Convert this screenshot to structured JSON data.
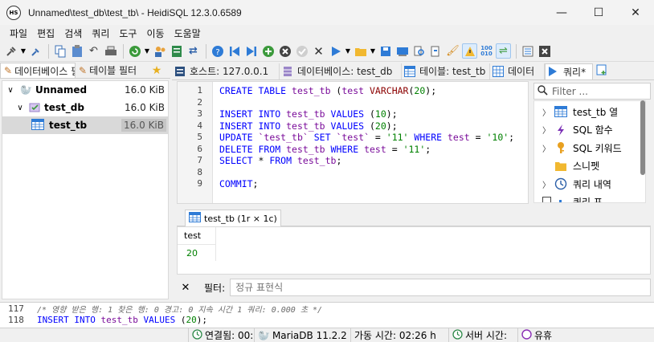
{
  "window": {
    "title": "Unnamed\\test_db\\test_tb\\ - HeidiSQL 12.3.0.6589",
    "icon_text": "HS",
    "minimize": "—",
    "maximize": "☐",
    "close": "✕"
  },
  "menu": [
    "파일",
    "편집",
    "검색",
    "쿼리",
    "도구",
    "이동",
    "도움말"
  ],
  "left_tabs": {
    "database_filter": "데이터베이스 필터",
    "table_filter": "테이블 필터"
  },
  "tree": [
    {
      "label": "Unnamed",
      "size": "16.0 KiB"
    },
    {
      "label": "test_db",
      "size": "16.0 KiB"
    },
    {
      "label": "test_tb",
      "size": "16.0 KiB"
    }
  ],
  "right_tabs": [
    {
      "label": "호스트: 127.0.0.1"
    },
    {
      "label": "데이터베이스: test_db"
    },
    {
      "label": "테이블: test_tb"
    },
    {
      "label": "데이터"
    },
    {
      "label": "쿼리*"
    }
  ],
  "editor": {
    "line_numbers": [
      "1",
      "2",
      "3",
      "4",
      "5",
      "6",
      "7",
      "8",
      "9"
    ]
  },
  "helpers": {
    "filter_placeholder": "Filter ...",
    "items": [
      {
        "label": "test_tb 열",
        "icon": "table-icon"
      },
      {
        "label": "SQL 함수",
        "icon": "function-icon"
      },
      {
        "label": "SQL 키워드",
        "icon": "key-icon"
      },
      {
        "label": "스니펫",
        "icon": "folder-icon"
      },
      {
        "label": "쿼리 내역",
        "icon": "clock-icon"
      },
      {
        "label": "쿼리 프",
        "icon": "profile-icon"
      }
    ]
  },
  "result": {
    "tab_label": "test_tb (1r × 1c)",
    "column": "test",
    "value": "20"
  },
  "filter": {
    "label": "필터:",
    "placeholder": "정규 표현식"
  },
  "log": [
    {
      "ln": "117",
      "text": "/* 영향 받은 행: 1  찾은 행: 0  경고: 0  지속 시간 1 쿼리: 0.000 초 */"
    },
    {
      "ln": "118"
    }
  ],
  "status": {
    "connected": "연결됨: 00:",
    "server": "MariaDB 11.2.2",
    "uptime": "가동 시간: 02:26 h",
    "server_time": "서버 시간:",
    "idle": "유휴"
  },
  "colors": {
    "keyword": "#0000ff",
    "identifier": "#7a0c9a",
    "string": "#008000",
    "type": "#8b0000"
  }
}
